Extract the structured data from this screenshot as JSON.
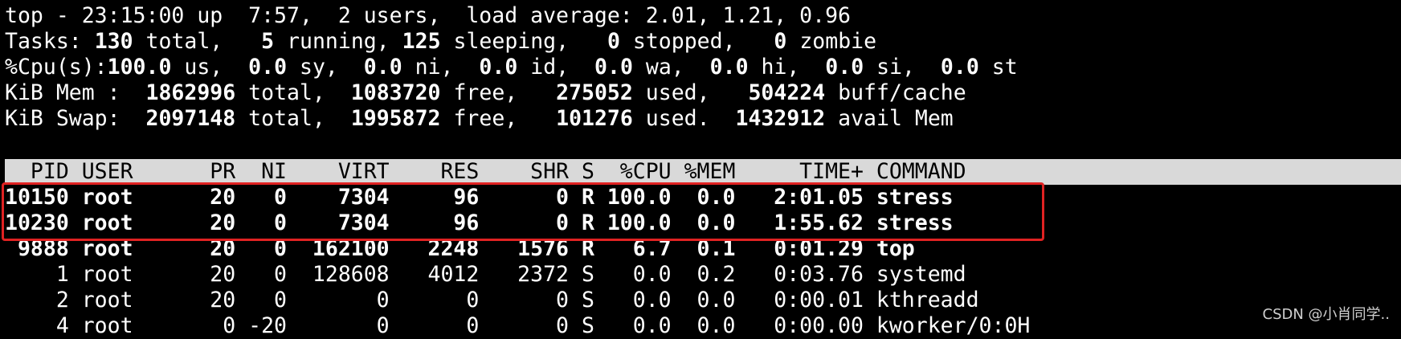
{
  "summary": {
    "line1": "top - 23:15:00 up  7:57,  2 users,  load average: 2.01, 1.21, 0.96",
    "tasks": {
      "label": "Tasks:",
      "total": "130",
      "total_lbl": " total,",
      "running": "5",
      "running_lbl": " running,",
      "sleeping": "125",
      "sleeping_lbl": " sleeping,",
      "stopped": "0",
      "stopped_lbl": " stopped,",
      "zombie": "0",
      "zombie_lbl": " zombie"
    },
    "cpu": {
      "label": "%Cpu(s):",
      "us": "100.0",
      "us_lbl": " us,",
      "sy": "0.0",
      "sy_lbl": " sy,",
      "ni": "0.0",
      "ni_lbl": " ni,",
      "id": "0.0",
      "id_lbl": " id,",
      "wa": "0.0",
      "wa_lbl": " wa,",
      "hi": "0.0",
      "hi_lbl": " hi,",
      "si": "0.0",
      "si_lbl": " si,",
      "st": "0.0",
      "st_lbl": " st"
    },
    "mem": {
      "label": "KiB Mem :",
      "total": "1862996",
      "total_lbl": " total,",
      "free": "1083720",
      "free_lbl": " free,",
      "used": "275052",
      "used_lbl": " used,",
      "buff": "504224",
      "buff_lbl": " buff/cache"
    },
    "swap": {
      "label": "KiB Swap:",
      "total": "2097148",
      "total_lbl": " total,",
      "free": "1995872",
      "free_lbl": " free,",
      "used": "101276",
      "used_lbl": " used.",
      "avail": "1432912",
      "avail_lbl": " avail Mem"
    }
  },
  "table": {
    "header": "  PID USER      PR  NI    VIRT    RES    SHR S  %CPU %MEM     TIME+ COMMAND",
    "rows": [
      {
        "text": "10150 root      20   0    7304     96      0 R 100.0  0.0   2:01.05 stress",
        "bold": true
      },
      {
        "text": "10230 root      20   0    7304     96      0 R 100.0  0.0   1:55.62 stress",
        "bold": true
      },
      {
        "text": " 9888 root      20   0  162100   2248   1576 R   6.7  0.1   0:01.29 top",
        "bold": true
      },
      {
        "text": "    1 root      20   0  128608   4012   2372 S   0.0  0.2   0:03.76 systemd",
        "bold": false
      },
      {
        "text": "    2 root      20   0       0      0      0 S   0.0  0.0   0:00.01 kthreadd",
        "bold": false
      },
      {
        "text": "    4 root       0 -20       0      0      0 S   0.0  0.0   0:00.00 kworker/0:0H",
        "bold": false
      }
    ]
  },
  "watermark": "CSDN @小肖同学.."
}
